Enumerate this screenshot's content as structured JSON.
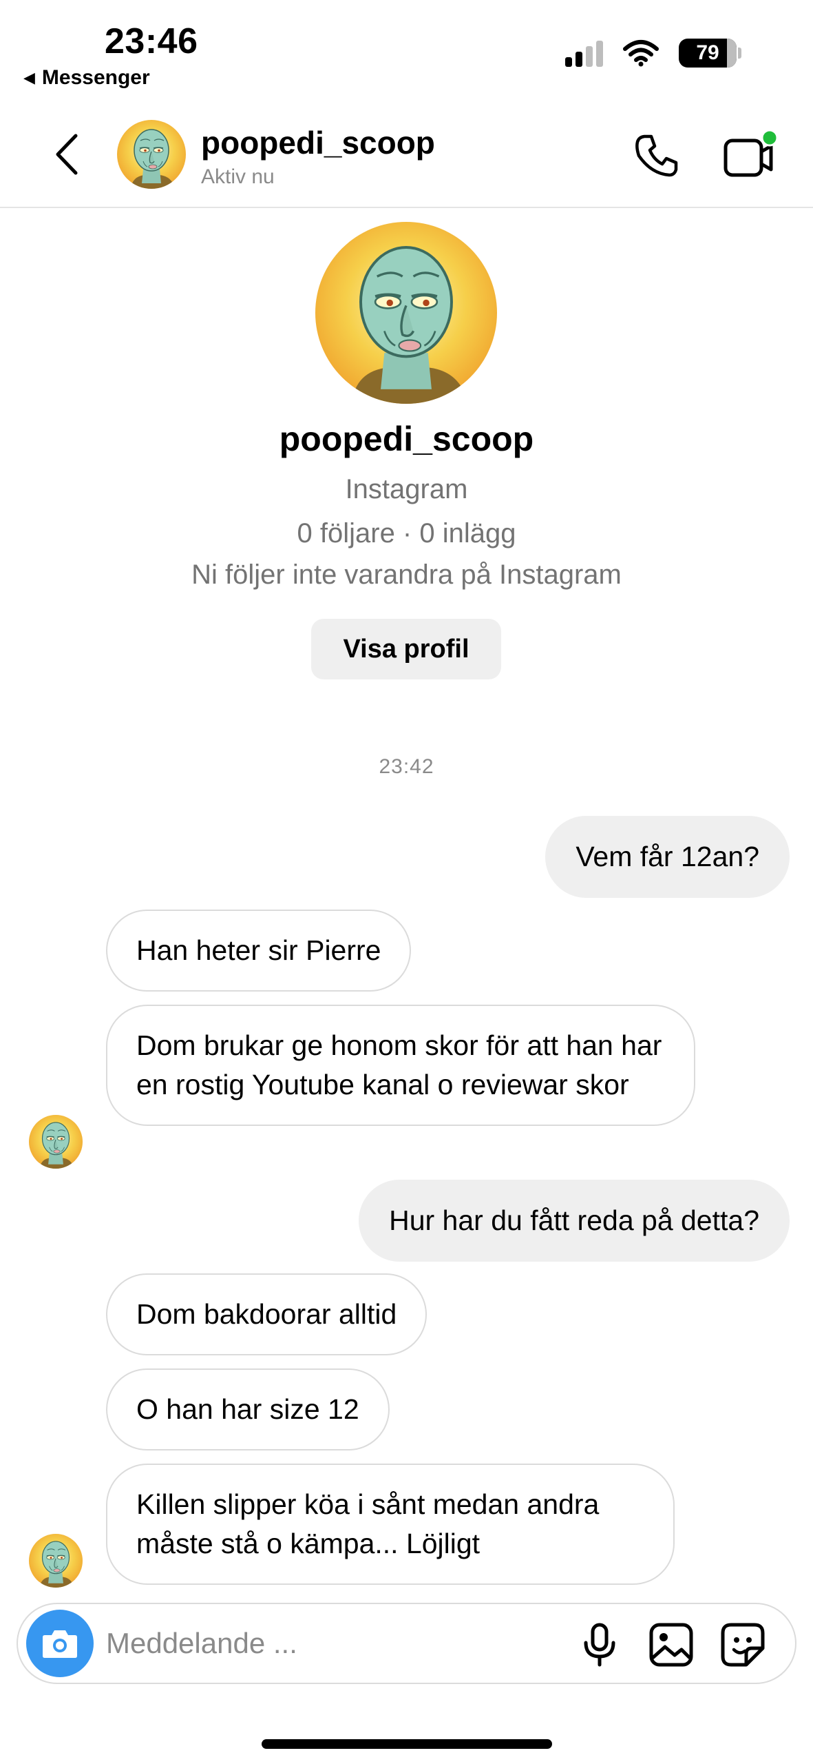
{
  "status_bar": {
    "time": "23:46",
    "back_app": "Messenger",
    "battery": "79"
  },
  "header": {
    "contact_name": "poopedi_scoop",
    "activity": "Aktiv nu",
    "icons": {
      "back": "chevron-left-icon",
      "call": "phone-icon",
      "video": "video-camera-icon"
    },
    "colors": {
      "online_dot": "#1fbd3a"
    }
  },
  "profile": {
    "name": "poopedi_scoop",
    "platform": "Instagram",
    "stats": "0 följare · 0 inlägg",
    "follow_status": "Ni följer inte varandra på Instagram",
    "view_profile_label": "Visa profil"
  },
  "conversation": {
    "timestamp": "23:42",
    "messages": [
      {
        "direction": "out",
        "text": "Vem får 12an?"
      },
      {
        "direction": "in",
        "text": "Han heter sir Pierre"
      },
      {
        "direction": "in",
        "text": "Dom brukar ge honom skor för att han har en rostig Youtube kanal o reviewar skor"
      },
      {
        "direction": "out",
        "text": "Hur har du fått reda på detta?"
      },
      {
        "direction": "in",
        "text": "Dom bakdoorar alltid"
      },
      {
        "direction": "in",
        "text": "O han har size 12"
      },
      {
        "direction": "in",
        "text": "Killen slipper köa i sånt medan andra måste stå o kämpa... Löjligt"
      }
    ]
  },
  "composer": {
    "placeholder": "Meddelande ...",
    "value": "",
    "icons": [
      "camera-icon",
      "microphone-icon",
      "image-icon",
      "sticker-icon"
    ],
    "colors": {
      "camera_button": "#3797f0"
    }
  }
}
